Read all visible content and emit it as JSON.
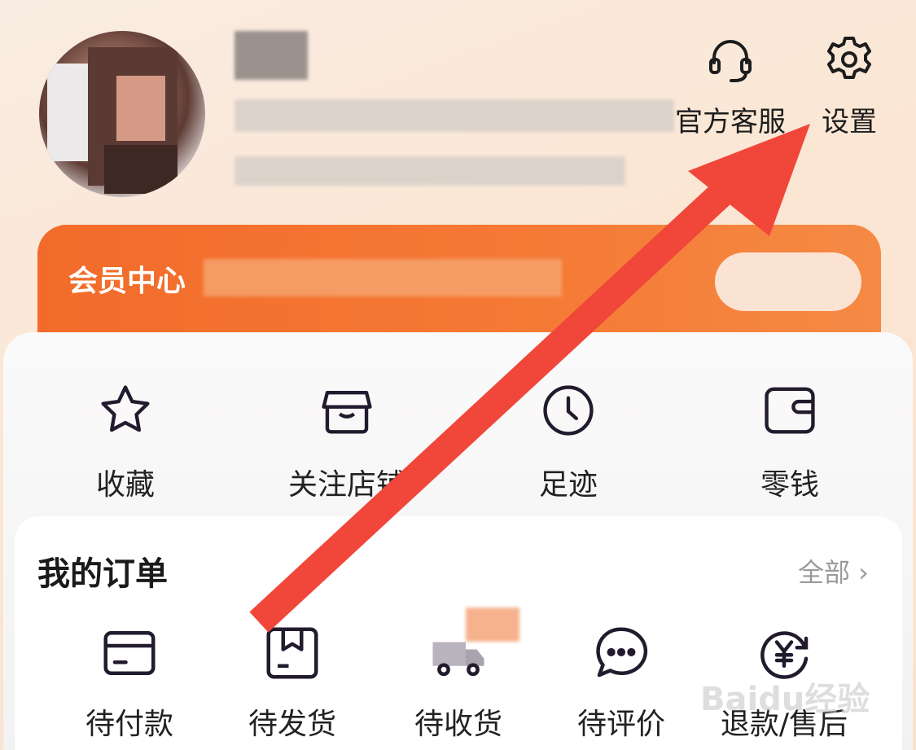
{
  "header": {
    "actions": [
      {
        "label": "官方客服",
        "icon": "headset-icon"
      },
      {
        "label": "设置",
        "icon": "gear-icon"
      }
    ]
  },
  "member": {
    "label": "会员中心"
  },
  "quick_links": [
    {
      "label": "收藏",
      "icon": "star-icon"
    },
    {
      "label": "关注店铺",
      "icon": "store-icon"
    },
    {
      "label": "足迹",
      "icon": "clock-icon"
    },
    {
      "label": "零钱",
      "icon": "wallet-icon"
    }
  ],
  "orders": {
    "title": "我的订单",
    "view_all": "全部 ›",
    "items": [
      {
        "label": "待付款",
        "icon": "card-icon"
      },
      {
        "label": "待发货",
        "icon": "package-icon"
      },
      {
        "label": "待收货",
        "icon": "truck-icon"
      },
      {
        "label": "待评价",
        "icon": "chat-icon"
      },
      {
        "label": "退款/售后",
        "icon": "refund-icon"
      }
    ]
  },
  "watermark": "Baidu经验",
  "colors": {
    "accent": "#f26b2a",
    "arrow": "#f0473a"
  }
}
